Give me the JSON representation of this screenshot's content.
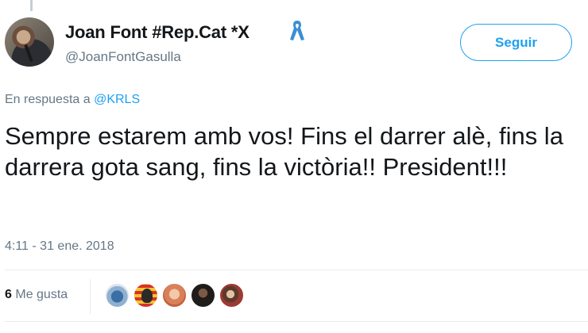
{
  "tweet": {
    "author": {
      "display_name": "Joan Font #Rep.Cat *X",
      "handle": "@JoanFontGasulla",
      "badge_icon": "blue-ribbon-icon"
    },
    "follow_label": "Seguir",
    "reply_context": {
      "prefix": "En respuesta a",
      "mention": "@KRLS"
    },
    "text": "Sempre estarem amb vos! Fins el darrer alè, fins la darrera gota sang, fins la victòria!! President!!!",
    "timestamp": "4:11 - 31 ene. 2018",
    "likes": {
      "count": "6",
      "label": "Me gusta"
    }
  },
  "colors": {
    "accent": "#1da1f2",
    "secondary_text": "#657786",
    "primary_text": "#14171a",
    "ribbon": "#3b8fd4"
  }
}
